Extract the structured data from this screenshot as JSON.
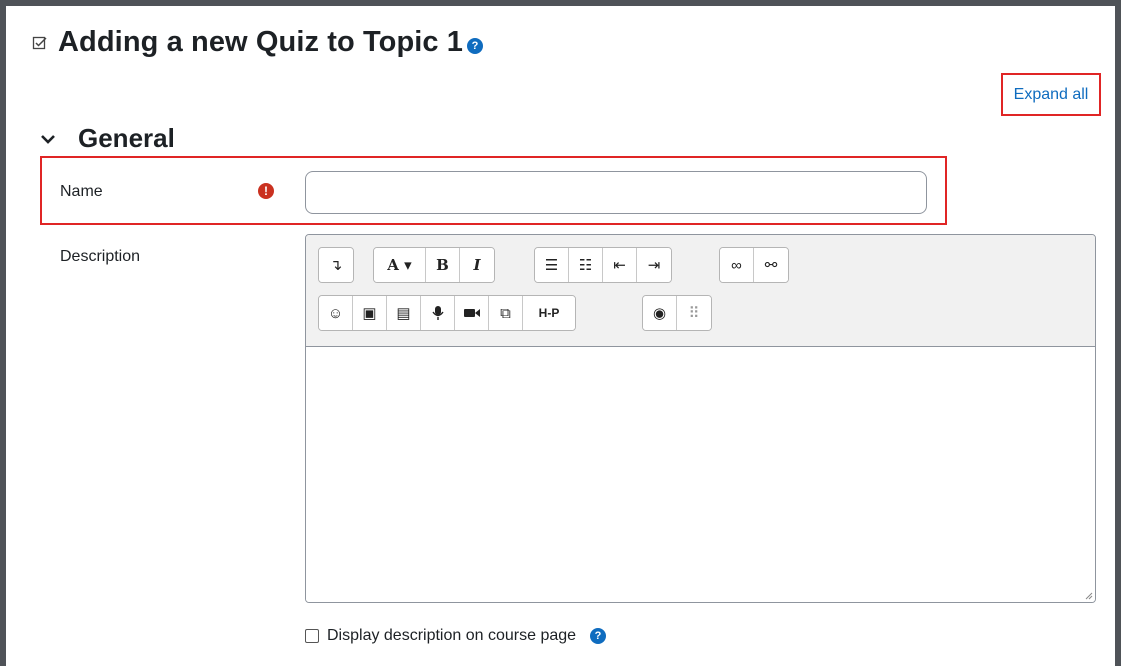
{
  "header": {
    "title": "Adding a new Quiz to Topic 1",
    "title_icon": "quiz-icon",
    "help_icon": "question-circle-icon"
  },
  "actions": {
    "expand_all": "Expand all"
  },
  "section": {
    "title": "General",
    "icon": "chevron-down-icon"
  },
  "form": {
    "name": {
      "label": "Name",
      "value": "",
      "placeholder": "",
      "required_icon": "exclamation-circle-icon"
    },
    "description": {
      "label": "Description",
      "value": "",
      "toolbar_row1": [
        {
          "icon": "collapse-toolbar-icon",
          "glyph": "↴"
        },
        {
          "icon": "font-style-icon",
          "glyph": "A ▾"
        },
        {
          "icon": "bold-icon",
          "glyph": "B"
        },
        {
          "icon": "italic-icon",
          "glyph": "I"
        },
        {
          "icon": "unordered-list-icon",
          "glyph": "☰"
        },
        {
          "icon": "ordered-list-icon",
          "glyph": "☷"
        },
        {
          "icon": "outdent-icon",
          "glyph": "⇤"
        },
        {
          "icon": "indent-icon",
          "glyph": "⇥"
        },
        {
          "icon": "link-icon",
          "glyph": "∞"
        },
        {
          "icon": "unlink-icon",
          "glyph": "⚯"
        }
      ],
      "toolbar_row2": [
        {
          "icon": "emoji-icon",
          "glyph": "☺"
        },
        {
          "icon": "image-icon",
          "glyph": "▣"
        },
        {
          "icon": "media-icon",
          "glyph": "▤"
        },
        {
          "icon": "record-audio-icon",
          "glyph": "🎙"
        },
        {
          "icon": "record-video-icon",
          "glyph": "■"
        },
        {
          "icon": "manage-files-icon",
          "glyph": "⧉"
        },
        {
          "icon": "h5p-icon",
          "glyph": "H-P"
        },
        {
          "icon": "accessibility-checker-icon",
          "glyph": "◉"
        },
        {
          "icon": "screenreader-helper-icon",
          "glyph": "⠿"
        }
      ]
    },
    "display_description": {
      "label": "Display description on course page",
      "checked": false
    }
  },
  "colors": {
    "accent": "#0f6cbf",
    "highlight_box": "#e02525",
    "required": "#ca3120",
    "frame": "#4f5358"
  }
}
